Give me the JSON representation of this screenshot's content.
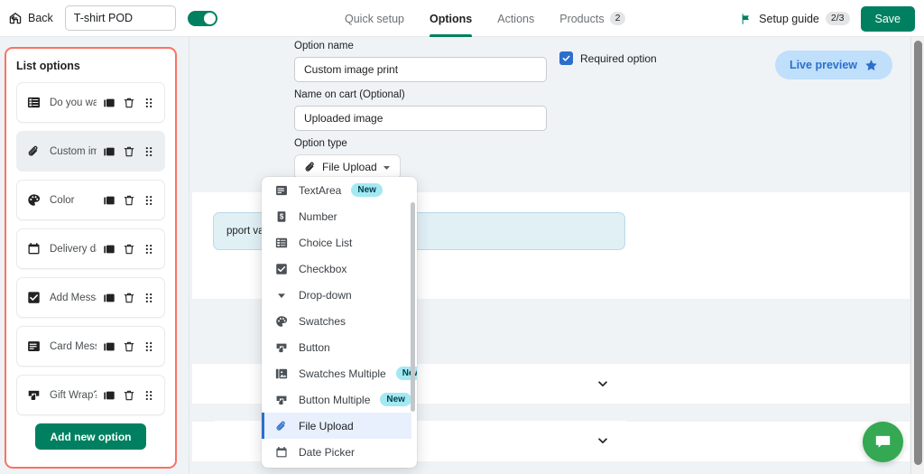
{
  "topbar": {
    "back_label": "Back",
    "back_icon": "back-arrow-icon",
    "title_value": "T-shirt POD",
    "title_placeholder": "Option set name",
    "toggle_state": "on",
    "tabs": [
      {
        "label": "Quick setup",
        "active": false,
        "count": ""
      },
      {
        "label": "Options",
        "active": true,
        "count": ""
      },
      {
        "label": "Actions",
        "active": false,
        "count": ""
      },
      {
        "label": "Products",
        "active": false,
        "count": "2"
      }
    ],
    "setup_guide_label": "Setup guide",
    "setup_guide_count": "2/3",
    "setup_guide_icon": "flag-icon",
    "save_label": "Save"
  },
  "sidebar": {
    "title": "List options",
    "highlight_color": "#fa7265",
    "items": [
      {
        "label": "Do you want ...",
        "icon": "choice-list-icon",
        "selected": false
      },
      {
        "label": "Custom imag...",
        "icon": "paperclip-icon",
        "selected": true
      },
      {
        "label": "Color",
        "icon": "palette-icon",
        "selected": false
      },
      {
        "label": "Delivery date",
        "icon": "calendar-icon",
        "selected": false
      },
      {
        "label": "Add Message?",
        "icon": "checkbox-icon",
        "selected": false
      },
      {
        "label": "Card Messag...",
        "icon": "textarea-icon",
        "selected": false
      },
      {
        "label": "Gift Wrap?",
        "icon": "button-icon",
        "selected": false
      }
    ],
    "row_actions": [
      {
        "name": "duplicate-icon",
        "title": "Duplicate"
      },
      {
        "name": "delete-icon",
        "title": "Delete"
      },
      {
        "name": "drag-handle-icon",
        "title": "Reorder"
      }
    ],
    "add_button_label": "Add new option",
    "add_button_color": "#008060"
  },
  "form": {
    "option_name_label": "Option name",
    "option_name_value": "Custom image print",
    "option_name_placeholder": "Enter option name",
    "name_on_cart_label": "Name on cart (Optional)",
    "name_on_cart_value": "Uploaded image",
    "name_on_cart_placeholder": "Enter name on cart",
    "option_type_label": "Option type",
    "option_type_value": "File Upload",
    "option_type_icon": "paperclip-icon",
    "required_option_label": "Required option",
    "required_option_checked": true,
    "required_checkbox_color": "#2c6ecb",
    "live_preview_label": "Live preview",
    "live_preview_icon": "star-icon",
    "live_preview_bg": "#bfdffb",
    "live_preview_fg": "#2c6ecb",
    "info_banner_text": "pport values",
    "info_banner_bg": "#e0f0f5"
  },
  "dropdown": {
    "scroll_position": "near-bottom",
    "items": [
      {
        "label": "TextArea",
        "icon": "textarea-icon",
        "badge": "New",
        "active": false
      },
      {
        "label": "Number",
        "icon": "number-icon",
        "badge": "",
        "active": false
      },
      {
        "label": "Choice List",
        "icon": "choice-list-icon",
        "badge": "",
        "active": false
      },
      {
        "label": "Checkbox",
        "icon": "checkbox-icon",
        "badge": "",
        "active": false
      },
      {
        "label": "Drop-down",
        "icon": "caret-down-icon",
        "badge": "",
        "active": false
      },
      {
        "label": "Swatches",
        "icon": "palette-icon",
        "badge": "",
        "active": false
      },
      {
        "label": "Button",
        "icon": "button-icon",
        "badge": "",
        "active": false
      },
      {
        "label": "Swatches Multiple",
        "icon": "image-icon",
        "badge": "New",
        "active": false
      },
      {
        "label": "Button Multiple",
        "icon": "button-icon",
        "badge": "New",
        "active": false
      },
      {
        "label": "File Upload",
        "icon": "paperclip-icon",
        "badge": "",
        "active": true
      },
      {
        "label": "Date Picker",
        "icon": "calendar-icon",
        "badge": "",
        "active": false
      }
    ]
  },
  "accordions": [
    {
      "label": "",
      "icon": "chevron-down-icon",
      "expanded": false
    },
    {
      "label": "",
      "icon": "chevron-down-icon",
      "expanded": false
    }
  ],
  "chat": {
    "icon": "chat-bubble-icon",
    "color": "#34a853"
  }
}
